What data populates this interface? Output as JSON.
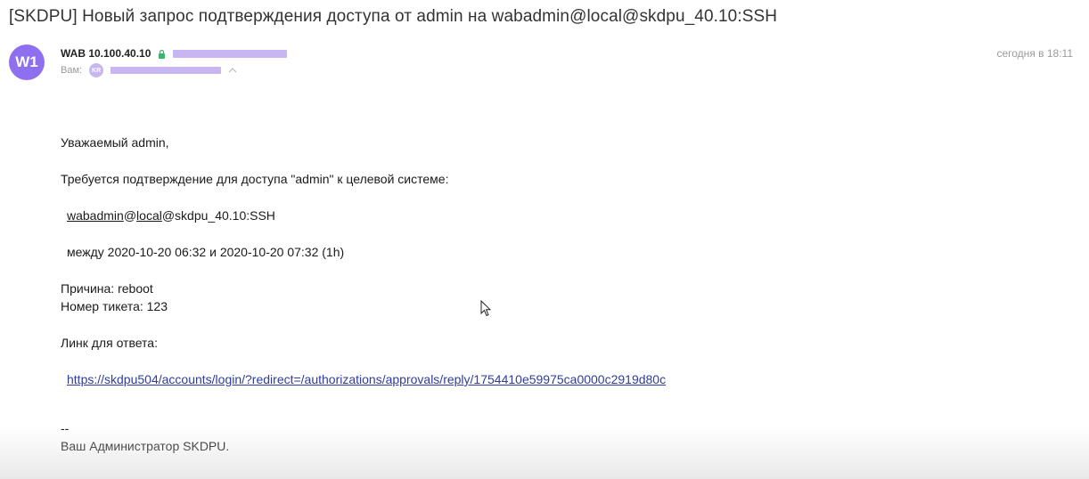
{
  "email": {
    "subject": "[SKDPU] Новый запрос подтверждения доступа от admin на wabadmin@local@skdpu_40.10:SSH",
    "sender": {
      "avatar_initials": "W1",
      "name": "WAB 10.100.40.10",
      "icon": "lock-icon"
    },
    "recipient": {
      "label": "Вам:",
      "avatar_initials": "KR"
    },
    "date": "сегодня в 18:11",
    "body": {
      "greeting": "Уважаемый admin,",
      "intro": "Требуется подтверждение для доступа \"admin\" к целевой системе:",
      "target_user": "wabadmin",
      "target_at1": "@",
      "target_domain": "local",
      "target_rest": "@skdpu_40.10:SSH",
      "period": "между 2020-10-20 06:32 и 2020-10-20 07:32 (1h)",
      "reason": "Причина: reboot",
      "ticket": "Номер тикета: 123",
      "link_label": "Линк для ответа:",
      "link_url": "https://skdpu504/accounts/login/?redirect=/authorizations/approvals/reply/1754410e59975ca0000c2919d80c",
      "sign_dashes": "--",
      "signature": "Ваш Администратор SKDPU."
    }
  },
  "colors": {
    "avatar": "#8e6ff0",
    "redaction": "#c8b6f2",
    "link": "#2e3c9e",
    "lock": "#3cb371"
  }
}
